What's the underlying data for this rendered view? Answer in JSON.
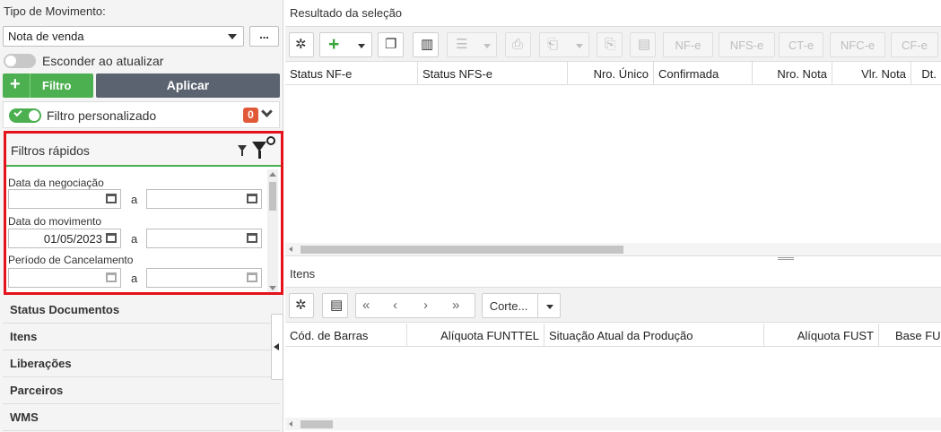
{
  "left": {
    "tipo_movimento_label": "Tipo de Movimento:",
    "tipo_movimento_value": "Nota de venda",
    "dots_label": "...",
    "esconder_label": "Esconder ao atualizar",
    "filtro_plus": "+",
    "filtro_label": "Filtro",
    "aplicar_label": "Aplicar",
    "filtro_personalizado_label": "Filtro personalizado",
    "filtro_personalizado_count": "0",
    "quick_filters": {
      "title": "Filtros rápidos",
      "fields": [
        {
          "label": "Data da negociação",
          "from": "",
          "to": ""
        },
        {
          "label": "Data do movimento",
          "from": "01/05/2023",
          "to": ""
        },
        {
          "label": "Período de Cancelamento",
          "from": "",
          "to": ""
        }
      ],
      "range_sep": "a"
    },
    "accordion": [
      "Status Documentos",
      "Itens",
      "Liberações",
      "Parceiros",
      "WMS"
    ]
  },
  "resultado": {
    "title": "Resultado da seleção",
    "doc_buttons": [
      "NF-e",
      "NFS-e",
      "CT-e",
      "NFC-e",
      "CF-e"
    ],
    "columns": [
      "Status NF-e",
      "Status NFS-e",
      "Nro. Único",
      "Confirmada",
      "Nro. Nota",
      "Vlr. Nota",
      "Dt."
    ]
  },
  "itens": {
    "title": "Itens",
    "corte_label": "Corte...",
    "columns": [
      "Cód. de Barras",
      "Alíquota FUNTTEL",
      "Situação Atual da Produção",
      "Alíquota FUST",
      "Base FU"
    ]
  },
  "icons": {
    "settings": "gear-icon",
    "add": "plus-icon",
    "copy": "copy-icon",
    "delete": "trash-icon",
    "first": "double-chevron-left-icon",
    "prev": "chevron-left-icon",
    "next": "chevron-right-icon",
    "last": "double-chevron-right-icon"
  },
  "colors": {
    "green": "#4caf50",
    "dark_button": "#5b6370",
    "highlight": "#e4121a",
    "badge": "#e05a3a"
  }
}
